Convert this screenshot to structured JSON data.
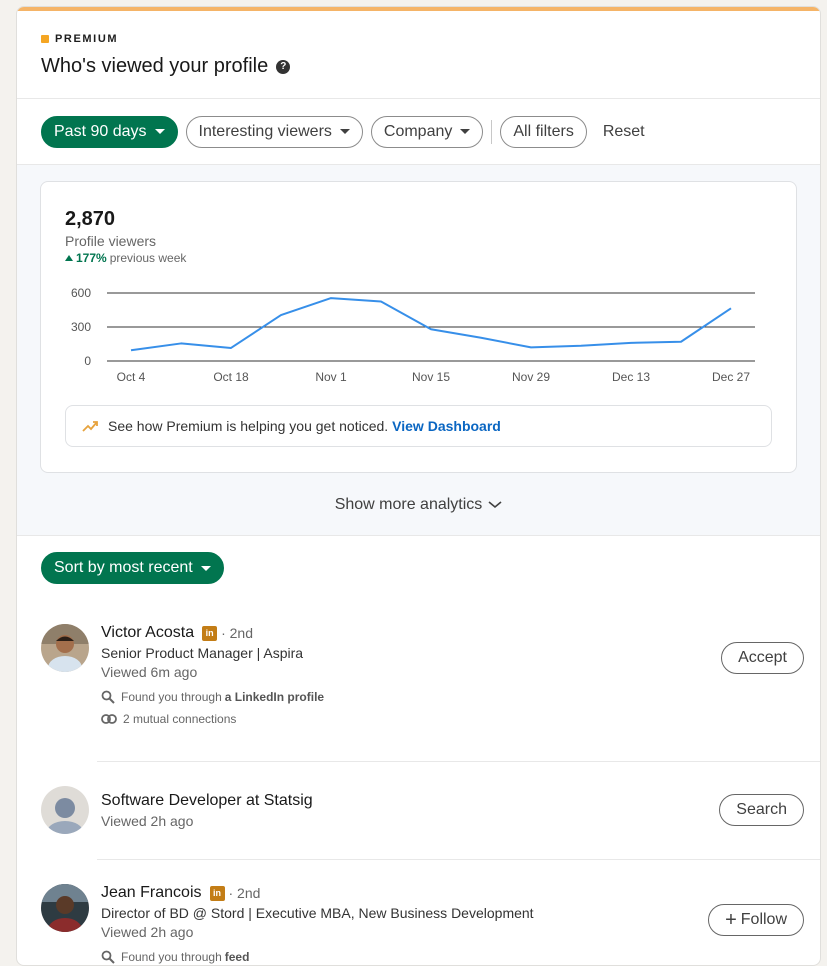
{
  "header": {
    "premium_label": "PREMIUM",
    "title": "Who's viewed your profile",
    "help_symbol": "?"
  },
  "filters": {
    "time_range": "Past 90 days",
    "interesting_viewers": "Interesting viewers",
    "company": "Company",
    "all_filters": "All filters",
    "reset": "Reset"
  },
  "analytics": {
    "viewer_count": "2,870",
    "viewer_label": "Profile viewers",
    "trend_value": "177%",
    "trend_label": "previous week",
    "banner_text": "See how Premium is helping you get noticed.",
    "banner_link": "View Dashboard",
    "show_more": "Show more analytics"
  },
  "chart_data": {
    "type": "line",
    "x": [
      "Oct 4",
      "Oct 11",
      "Oct 18",
      "Oct 25",
      "Nov 1",
      "Nov 8",
      "Nov 15",
      "Nov 22",
      "Nov 29",
      "Dec 6",
      "Dec 13",
      "Dec 20",
      "Dec 27"
    ],
    "tick_labels": [
      "Oct 4",
      "Oct 18",
      "Nov 1",
      "Nov 15",
      "Nov 29",
      "Dec 13",
      "Dec 27"
    ],
    "values": [
      95,
      155,
      115,
      405,
      555,
      525,
      280,
      205,
      120,
      135,
      160,
      170,
      465
    ],
    "yticks": [
      0,
      300,
      600
    ],
    "ylim": [
      0,
      600
    ],
    "grid": true,
    "color": "#378fe9"
  },
  "sort": {
    "label": "Sort by most recent"
  },
  "viewers": [
    {
      "name": "Victor Acosta",
      "badge": "in",
      "degree": "· 2nd",
      "headline": "Senior Product Manager | Aspira",
      "viewed": "Viewed 6m ago",
      "found_prefix": "Found you through",
      "found_source": "a LinkedIn profile",
      "mutual": "2 mutual connections",
      "action": "Accept"
    },
    {
      "name": "Software Developer at Statsig",
      "viewed": "Viewed 2h ago",
      "action": "Search"
    },
    {
      "name": "Jean Francois",
      "badge": "in",
      "degree": "· 2nd",
      "headline": "Director of BD @ Stord | Executive MBA, New Business Development",
      "viewed": "Viewed 2h ago",
      "found_prefix": "Found you through",
      "found_source": "feed",
      "action_icon": "+",
      "action": "Follow"
    }
  ],
  "colors": {
    "accent_green": "#01754f",
    "premium_gold": "#f5b467",
    "link_blue": "#0a66c2"
  }
}
